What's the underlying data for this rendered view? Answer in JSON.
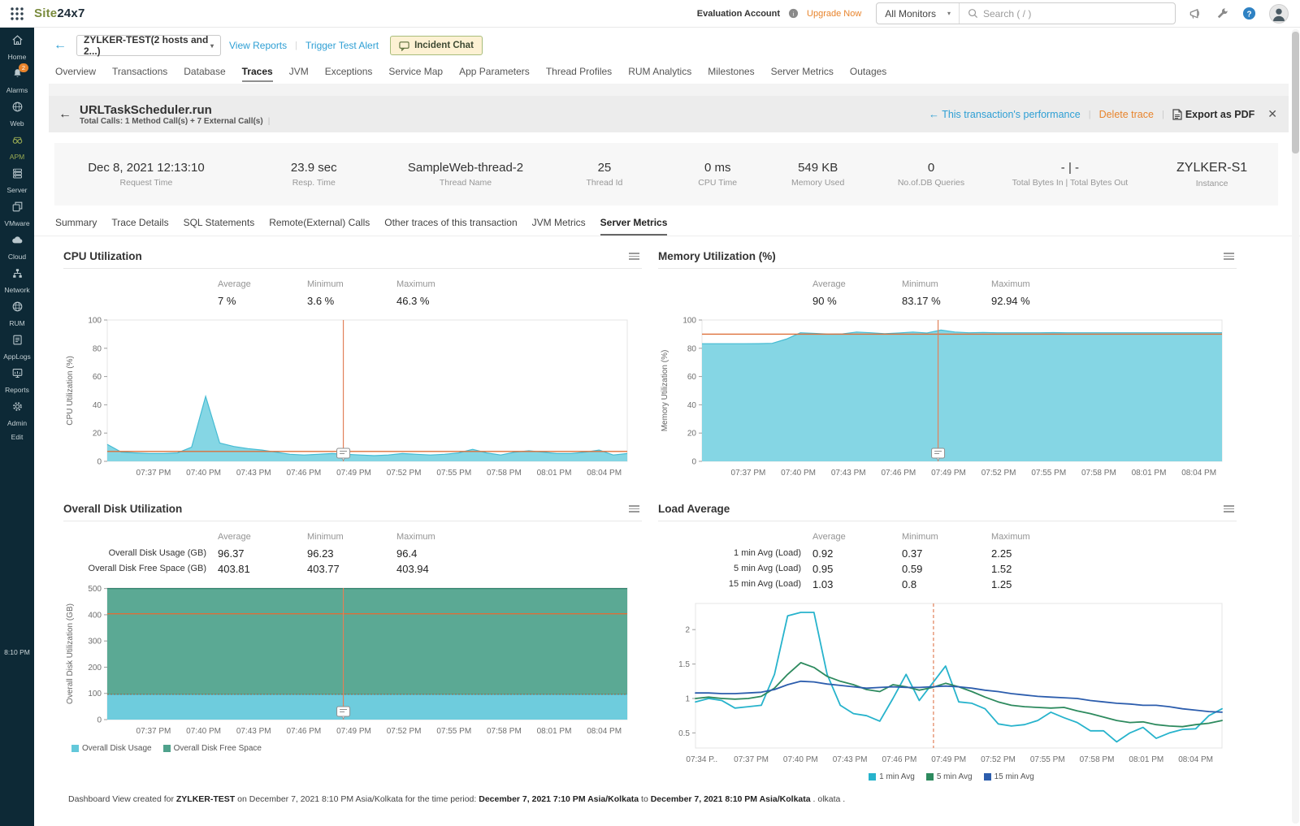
{
  "topbar": {
    "logo_part1": "Site",
    "logo_part2": "24x7",
    "evaluation_account": "Evaluation Account",
    "upgrade_now": "Upgrade Now",
    "monitor_filter": "All Monitors",
    "search_placeholder": "Search ( / )"
  },
  "sidebar": {
    "time": "8:10 PM",
    "items": [
      {
        "id": "home",
        "label": "Home"
      },
      {
        "id": "alarms",
        "label": "Alarms",
        "badge": "2"
      },
      {
        "id": "web",
        "label": "Web"
      },
      {
        "id": "apm",
        "label": "APM",
        "active": true
      },
      {
        "id": "server",
        "label": "Server"
      },
      {
        "id": "vmware",
        "label": "VMware"
      },
      {
        "id": "cloud",
        "label": "Cloud"
      },
      {
        "id": "network",
        "label": "Network"
      },
      {
        "id": "rum",
        "label": "RUM"
      },
      {
        "id": "applogs",
        "label": "AppLogs"
      },
      {
        "id": "reports",
        "label": "Reports"
      },
      {
        "id": "admin",
        "label": "Admin"
      },
      {
        "id": "edit",
        "label": "Edit"
      }
    ]
  },
  "toolbar": {
    "monitor_selector": "ZYLKER-TEST(2 hosts and 2...)",
    "view_reports": "View Reports",
    "trigger_test_alert": "Trigger Test Alert",
    "incident_chat": "Incident Chat"
  },
  "nav_tabs": {
    "active": "Traces",
    "items": [
      "Overview",
      "Transactions",
      "Database",
      "Traces",
      "JVM",
      "Exceptions",
      "Service Map",
      "App Parameters",
      "Thread Profiles",
      "RUM Analytics",
      "Milestones",
      "Server Metrics",
      "Outages"
    ]
  },
  "trace_header": {
    "title": "URLTaskScheduler.run",
    "subtitle": "Total Calls: 1 Method Call(s) + 7 External Call(s)",
    "performance_link": "This transaction's performance",
    "delete_link": "Delete trace",
    "export_link": "Export as PDF"
  },
  "info_metrics": [
    {
      "value": "Dec 8, 2021 12:13:10",
      "label": "Request Time",
      "w": 15
    },
    {
      "value": "23.9 sec",
      "label": "Resp. Time",
      "w": 12.4
    },
    {
      "value": "SampleWeb-thread-2",
      "label": "Thread Name",
      "w": 12.4
    },
    {
      "value": "25",
      "label": "Thread Id",
      "w": 10.3
    },
    {
      "value": "0 ms",
      "label": "CPU Time",
      "w": 8.2
    },
    {
      "value": "549 KB",
      "label": "Memory Used",
      "w": 8.2
    },
    {
      "value": "0",
      "label": "No.of.DB Queries",
      "w": 10.3
    },
    {
      "value": "- | -",
      "label": "Total Bytes In | Total Bytes Out",
      "w": 12.4
    },
    {
      "value": "ZYLKER-S1",
      "label": "Instance",
      "w": 10.8,
      "instance": true
    }
  ],
  "subtabs": {
    "active": "Server Metrics",
    "items": [
      "Summary",
      "Trace Details",
      "SQL Statements",
      "Remote(External) Calls",
      "Other traces of this transaction",
      "JVM Metrics",
      "Server Metrics"
    ]
  },
  "footer": {
    "parts": [
      {
        "text": "Dashboard View created for ",
        "bold": false
      },
      {
        "text": "ZYLKER-TEST",
        "bold": true
      },
      {
        "text": " on December 7, 2021 8:10 PM Asia/Kolkata for the time period: ",
        "bold": false
      },
      {
        "text": "December 7, 2021 7:10 PM Asia/Kolkata",
        "bold": true
      },
      {
        "text": " to ",
        "bold": false
      },
      {
        "text": "December 7, 2021 8:10 PM Asia/Kolkata",
        "bold": true
      },
      {
        "text": " . olkata .",
        "bold": false
      }
    ]
  },
  "colors": {
    "accent_blue": "#2e9fd4",
    "accent_orange": "#e8842c",
    "sidebar_bg": "#0d2936",
    "sidebar_icon": "#b9c7cd",
    "sidebar_active": "#9aab53",
    "area_cyan": "#7cd3e2",
    "disk_usage_blue": "#63c8da",
    "disk_free_green": "#4fa28c",
    "load_1min": "#27b3cc",
    "load_5min": "#2d8a5e",
    "load_15min": "#2c5dad",
    "ref_orange": "#dd6f39",
    "vline_orange": "#e2815a"
  },
  "chart_data": [
    {
      "id": "cpu",
      "type": "area",
      "title": "CPU Utilization",
      "ylabel": "CPU Utilization (%)",
      "ylim": [
        0,
        100
      ],
      "yticks": [
        0,
        20,
        40,
        60,
        80,
        100
      ],
      "xticks": [
        "07:37 PM",
        "07:40 PM",
        "07:43 PM",
        "07:46 PM",
        "07:49 PM",
        "07:52 PM",
        "07:55 PM",
        "07:58 PM",
        "08:01 PM",
        "08:04 PM"
      ],
      "xtick_first": 0.089,
      "xtick_step": 0.0963,
      "stats": {
        "headers": [
          "Average",
          "Minimum",
          "Maximum"
        ],
        "rows": [
          {
            "label": "",
            "values": [
              "7 %",
              "3.6 %",
              "46.3 %"
            ]
          }
        ]
      },
      "series": [
        {
          "name": "CPU Utilization",
          "color": "#7cd3e2",
          "stroke": "#45bbd3",
          "values": [
            12,
            6.5,
            6,
            5.5,
            5.5,
            6,
            10,
            46,
            13,
            10.5,
            9,
            8,
            6.5,
            5,
            4.5,
            5,
            5.5,
            5,
            4.5,
            4,
            4.5,
            5.5,
            5,
            4.5,
            5,
            6,
            8.5,
            6,
            4.5,
            6.5,
            7.5,
            6.5,
            5.5,
            5.5,
            6.5,
            8,
            4.5,
            5.5
          ]
        }
      ],
      "avg_line": 7,
      "vline_frac": 0.454,
      "marker": true
    },
    {
      "id": "memory",
      "type": "area",
      "title": "Memory Utilization (%)",
      "ylabel": "Memory Utilization (%)",
      "ylim": [
        0,
        100
      ],
      "yticks": [
        0,
        20,
        40,
        60,
        80,
        100
      ],
      "xticks": [
        "07:37 PM",
        "07:40 PM",
        "07:43 PM",
        "07:46 PM",
        "07:49 PM",
        "07:52 PM",
        "07:55 PM",
        "07:58 PM",
        "08:01 PM",
        "08:04 PM"
      ],
      "xtick_first": 0.089,
      "xtick_step": 0.0963,
      "stats": {
        "headers": [
          "Average",
          "Minimum",
          "Maximum"
        ],
        "rows": [
          {
            "label": "",
            "values": [
              "90 %",
              "83.17 %",
              "92.94 %"
            ]
          }
        ]
      },
      "series": [
        {
          "name": "Memory Utilization",
          "color": "#7cd3e2",
          "stroke": "#45bbd3",
          "values": [
            83.2,
            83.2,
            83.2,
            83.2,
            83.3,
            83.5,
            86.5,
            91,
            90.5,
            90,
            90.2,
            91.5,
            91,
            90.3,
            90.8,
            91.5,
            90.8,
            92.9,
            91.5,
            91,
            91.2,
            91,
            91,
            91,
            91,
            91.1,
            91,
            91,
            91,
            91,
            91,
            91,
            91,
            91,
            91,
            91,
            91,
            91
          ]
        }
      ],
      "avg_line": 90,
      "vline_frac": 0.454,
      "marker": true
    },
    {
      "id": "disk",
      "type": "stacked-area",
      "title": "Overall Disk Utilization",
      "ylabel": "Overall Disk Utilization (GB)",
      "ylim": [
        0,
        502
      ],
      "yticks": [
        0,
        100,
        200,
        300,
        400,
        500
      ],
      "xticks": [
        "07:37 PM",
        "07:40 PM",
        "07:43 PM",
        "07:46 PM",
        "07:49 PM",
        "07:52 PM",
        "07:55 PM",
        "07:58 PM",
        "08:01 PM",
        "08:04 PM"
      ],
      "xtick_first": 0.089,
      "xtick_step": 0.0963,
      "stats": {
        "headers": [
          "Average",
          "Minimum",
          "Maximum"
        ],
        "rows": [
          {
            "label": "Overall Disk Usage (GB)",
            "values": [
              "96.37",
              "96.23",
              "96.4"
            ]
          },
          {
            "label": "Overall Disk Free Space (GB)",
            "values": [
              "403.81",
              "403.77",
              "403.94"
            ]
          }
        ]
      },
      "series": [
        {
          "name": "Overall Disk Usage",
          "color": "#63c8da",
          "stroke": "#3badc2",
          "values": [
            96.37,
            96.37,
            96.37,
            96.37,
            96.37,
            96.37,
            96.37,
            96.37,
            96.37,
            96.37
          ]
        },
        {
          "name": "Overall Disk Free Space",
          "color": "#4fa28c",
          "stroke": "#35836f",
          "values": [
            403.81,
            403.81,
            403.81,
            403.81,
            403.81,
            403.81,
            403.81,
            403.81,
            403.81,
            403.81
          ]
        }
      ],
      "avg_line": 403.81,
      "avg_line2": 96.37,
      "vline_frac": 0.454,
      "marker": true,
      "legend": [
        "Overall Disk Usage",
        "Overall Disk Free Space"
      ]
    },
    {
      "id": "load",
      "type": "line",
      "title": "Load Average",
      "ylabel": "",
      "ylim": [
        0.28,
        2.38
      ],
      "yticks": [
        0.5,
        1,
        1.5,
        2
      ],
      "xticks": [
        "07:34 P..",
        "07:37 PM",
        "07:40 PM",
        "07:43 PM",
        "07:46 PM",
        "07:49 PM",
        "07:52 PM",
        "07:55 PM",
        "07:58 PM",
        "08:01 PM",
        "08:04 PM"
      ],
      "xtick_first": 0.012,
      "xtick_step": 0.0938,
      "stats": {
        "headers": [
          "Average",
          "Minimum",
          "Maximum"
        ],
        "rows": [
          {
            "label": "1 min Avg (Load)",
            "values": [
              "0.92",
              "0.37",
              "2.25"
            ]
          },
          {
            "label": "5 min Avg (Load)",
            "values": [
              "0.95",
              "0.59",
              "1.52"
            ]
          },
          {
            "label": "15 min Avg (Load)",
            "values": [
              "1.03",
              "0.8",
              "1.25"
            ]
          }
        ]
      },
      "series": [
        {
          "name": "1 min Avg",
          "color": "#27b3cc",
          "values": [
            0.95,
            1.0,
            0.97,
            0.86,
            0.88,
            0.9,
            1.35,
            2.2,
            2.25,
            2.25,
            1.35,
            0.9,
            0.78,
            0.75,
            0.67,
            1.0,
            1.35,
            0.97,
            1.22,
            1.47,
            0.95,
            0.93,
            0.85,
            0.63,
            0.6,
            0.62,
            0.68,
            0.8,
            0.72,
            0.65,
            0.53,
            0.53,
            0.37,
            0.5,
            0.58,
            0.42,
            0.5,
            0.55,
            0.56,
            0.75,
            0.85
          ]
        },
        {
          "name": "5 min Avg",
          "color": "#2d8a5e",
          "values": [
            1.0,
            1.02,
            1.0,
            0.99,
            1.0,
            1.03,
            1.15,
            1.35,
            1.52,
            1.45,
            1.32,
            1.25,
            1.2,
            1.13,
            1.1,
            1.2,
            1.17,
            1.12,
            1.16,
            1.22,
            1.17,
            1.1,
            1.02,
            0.95,
            0.9,
            0.88,
            0.87,
            0.86,
            0.87,
            0.82,
            0.78,
            0.73,
            0.68,
            0.65,
            0.66,
            0.62,
            0.6,
            0.59,
            0.62,
            0.64,
            0.68
          ]
        },
        {
          "name": "15 min Avg",
          "color": "#2c5dad",
          "values": [
            1.08,
            1.08,
            1.07,
            1.07,
            1.08,
            1.09,
            1.13,
            1.2,
            1.25,
            1.24,
            1.21,
            1.19,
            1.17,
            1.15,
            1.16,
            1.17,
            1.16,
            1.16,
            1.17,
            1.18,
            1.17,
            1.15,
            1.12,
            1.1,
            1.07,
            1.05,
            1.03,
            1.02,
            1.01,
            1.0,
            0.97,
            0.95,
            0.93,
            0.92,
            0.9,
            0.9,
            0.88,
            0.85,
            0.83,
            0.81,
            0.8
          ]
        }
      ],
      "vline_frac": 0.452,
      "vline_dashed": true,
      "legend": [
        "1 min Avg",
        "5 min Avg",
        "15 min Avg"
      ]
    }
  ]
}
